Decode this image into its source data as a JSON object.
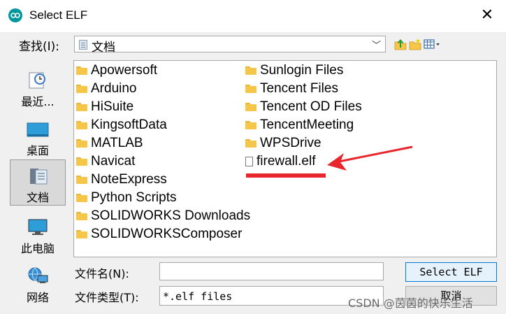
{
  "window": {
    "title": "Select ELF",
    "close_glyph": "✕"
  },
  "lookin": {
    "label": "查找(I):",
    "value": "文档"
  },
  "places": [
    {
      "label": "最近...",
      "icon": "recent-icon"
    },
    {
      "label": "桌面",
      "icon": "desktop-icon"
    },
    {
      "label": "文档",
      "icon": "documents-icon",
      "selected": true
    },
    {
      "label": "此电脑",
      "icon": "computer-icon"
    },
    {
      "label": "网络",
      "icon": "network-icon"
    }
  ],
  "files": {
    "col1": [
      "Apowersoft",
      "Arduino",
      "HiSuite",
      "KingsoftData",
      "MATLAB",
      "Navicat",
      "NoteExpress",
      "Python Scripts",
      "SOLIDWORKS Downloads",
      "SOLIDWORKSComposer"
    ],
    "col2": [
      "Sunlogin Files",
      "Tencent Files",
      "Tencent OD Files",
      "TencentMeeting",
      "WPSDrive"
    ],
    "file": "firewall.elf"
  },
  "filename": {
    "label": "文件名(N):",
    "value": ""
  },
  "filetype": {
    "label": "文件类型(T):",
    "value": "*.elf files"
  },
  "buttons": {
    "select": "Select ELF",
    "cancel": "取消"
  },
  "annotation_color": "#e8262d",
  "watermark": "CSDN @茵茵的快乐生活"
}
